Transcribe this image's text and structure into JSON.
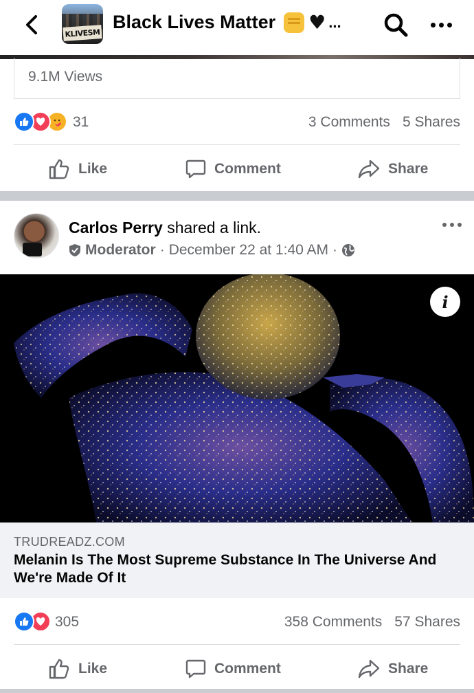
{
  "header": {
    "title": "Black Lives Matter",
    "title_ellipsis": "...",
    "thumb_sign_text": "KLIVESM",
    "icons": [
      "back-arrow-icon",
      "search-icon",
      "more-icon"
    ]
  },
  "post1": {
    "views": "9.1M Views",
    "reaction_count": "31",
    "comments": "3 Comments",
    "shares": "5 Shares"
  },
  "actions": {
    "like": "Like",
    "comment": "Comment",
    "share": "Share"
  },
  "post2": {
    "author": "Carlos Perry",
    "action_text": "shared a link.",
    "role": "Moderator",
    "separator": "·",
    "timestamp": "December 22 at 1:40 AM",
    "link_domain": "TRUDREADZ.COM",
    "link_title": "Melanin Is The Most Supreme Substance In The Universe And We're Made Of It",
    "info_label": "i",
    "reaction_count": "305",
    "comments": "358 Comments",
    "shares": "57 Shares"
  },
  "colors": {
    "like_blue": "#1877f2",
    "love_red": "#f33e58",
    "care_yellow": "#f7b125",
    "secondary_text": "#65676b",
    "divider": "#dadde1",
    "section_gap": "#c9ccd1"
  }
}
